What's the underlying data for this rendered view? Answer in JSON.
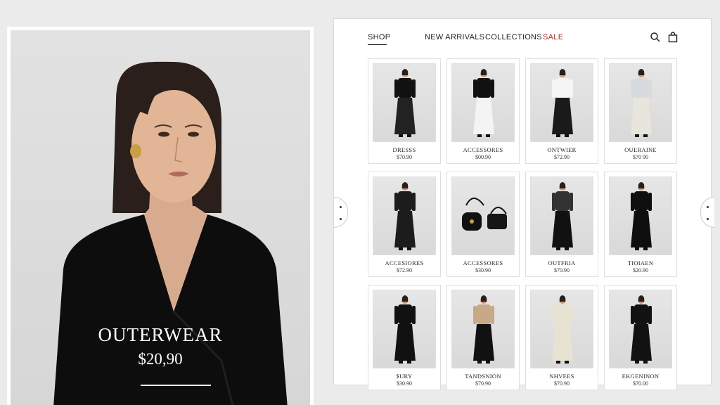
{
  "hero": {
    "title": "OUTERWEAR",
    "price": "$20,90"
  },
  "nav": {
    "shop": "SHOP",
    "new_arrivals": "NEW ARRIVALS",
    "collections": "COLLECTIONS",
    "sale": "SALE",
    "search_icon": "search-icon",
    "bag_icon": "shopping-bag-icon"
  },
  "colors": {
    "sale": "#a3302a",
    "text": "#222222",
    "background": "#ebebeb"
  },
  "products": [
    {
      "name": "DRESSS",
      "price": "$70.90"
    },
    {
      "name": "ACCESSORES",
      "price": "$00.90"
    },
    {
      "name": "ОNTWIER",
      "price": "$72.90"
    },
    {
      "name": "OUERAINE",
      "price": "$70 90"
    },
    {
      "name": "ACCESIORES",
      "price": "$72.90"
    },
    {
      "name": "ACCESSORES",
      "price": "$30.90"
    },
    {
      "name": "OUTFRIA",
      "price": "$70.90"
    },
    {
      "name": "ΤΙΟΙΑΕΝ",
      "price": "$20.90"
    },
    {
      "name": "$URY",
      "price": "$30.90"
    },
    {
      "name": "TANDSNION",
      "price": "$70.90"
    },
    {
      "name": "NHVEES",
      "price": "$70.90"
    },
    {
      "name": "EKGENINON",
      "price": "$70.00"
    }
  ]
}
